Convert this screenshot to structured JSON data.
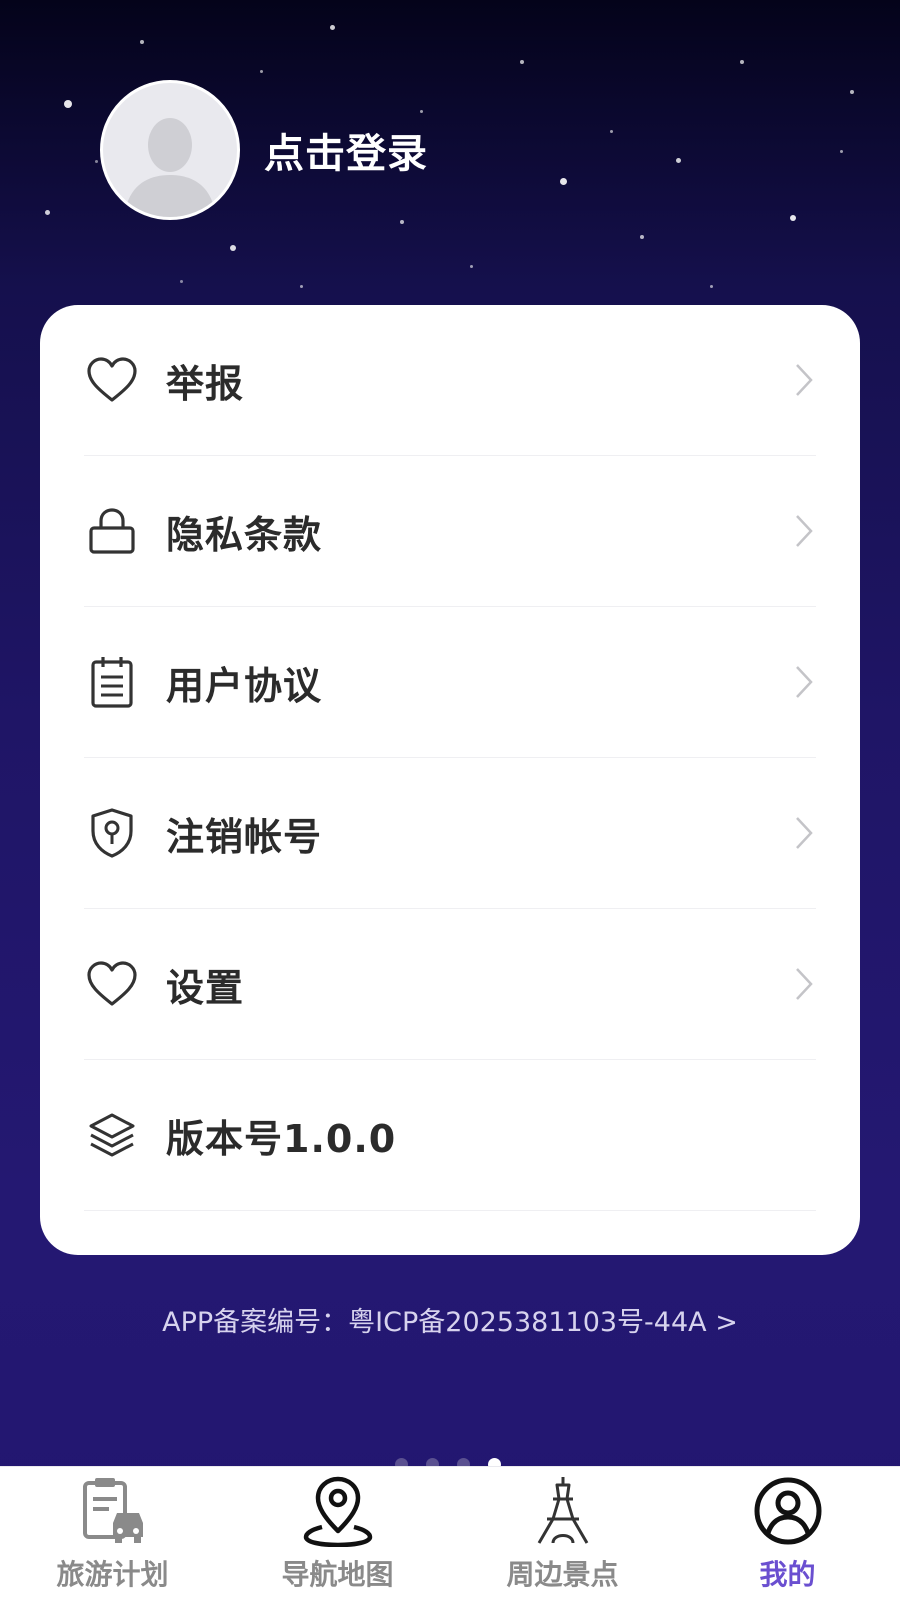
{
  "profile": {
    "login_label": "点击登录"
  },
  "menu": {
    "items": [
      {
        "label": "举报",
        "icon": "heart-icon"
      },
      {
        "label": "隐私条款",
        "icon": "lock-icon"
      },
      {
        "label": "用户协议",
        "icon": "document-icon"
      },
      {
        "label": "注销帐号",
        "icon": "shield-key-icon"
      },
      {
        "label": "设置",
        "icon": "heart-icon"
      },
      {
        "label": "版本号1.0.0",
        "icon": "layers-icon"
      }
    ]
  },
  "footer": {
    "icp": "APP备案编号：粤ICP备2025381103号-44A >"
  },
  "pager": {
    "count": 4,
    "active": 4
  },
  "tabbar": {
    "tabs": [
      {
        "label": "旅游计划",
        "icon": "clipboard-car-icon"
      },
      {
        "label": "导航地图",
        "icon": "map-pin-icon"
      },
      {
        "label": "周边景点",
        "icon": "tower-icon"
      },
      {
        "label": "我的",
        "icon": "user-circle-icon"
      }
    ],
    "active_tab": "我的"
  },
  "colors": {
    "background_top": "#04031a",
    "background_bottom": "#221670",
    "accent": "#6a4fd0",
    "tab_inactive": "#8a8a8a",
    "menu_text": "#2b2b2b"
  }
}
